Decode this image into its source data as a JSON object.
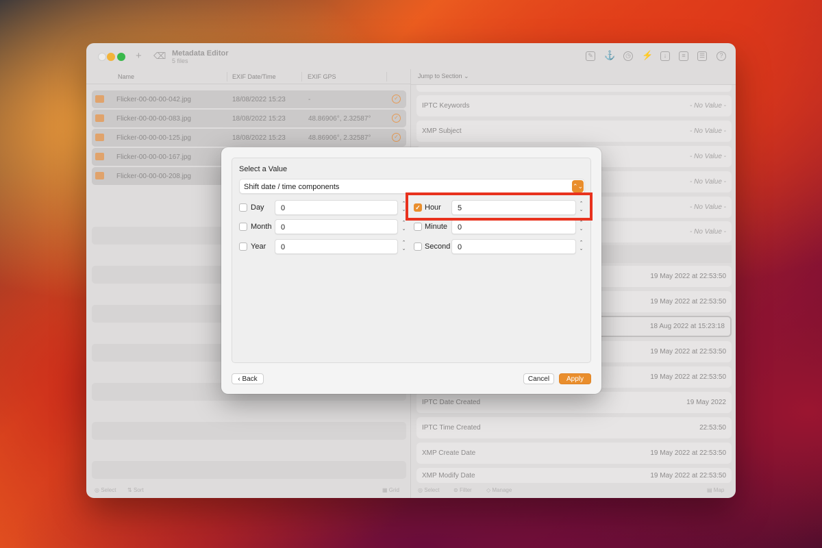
{
  "window": {
    "title": "Metadata Editor",
    "subtitle": "5 files",
    "add_icon": "plus-icon",
    "remove_icon": "delete-icon"
  },
  "toolbar_icons": [
    "edit-icon",
    "anchor-icon",
    "clock-icon",
    "lightning-icon",
    "import-icon",
    "document-icon",
    "list-icon",
    "help-icon"
  ],
  "file_list": {
    "columns": [
      "Name",
      "EXIF Date/Time",
      "EXIF GPS"
    ],
    "rows": [
      {
        "name": "Flicker-00-00-00-042.jpg",
        "date": "18/08/2022 15:23",
        "gps": "-"
      },
      {
        "name": "Flicker-00-00-00-083.jpg",
        "date": "18/08/2022 15:23",
        "gps": "48.86906°, 2.32587°"
      },
      {
        "name": "Flicker-00-00-00-125.jpg",
        "date": "18/08/2022 15:23",
        "gps": "48.86906°, 2.32587°"
      },
      {
        "name": "Flicker-00-00-00-167.jpg",
        "date": "",
        "gps": ""
      },
      {
        "name": "Flicker-00-00-00-208.jpg",
        "date": "",
        "gps": ""
      }
    ],
    "footer": {
      "select": "Select",
      "sort": "Sort",
      "grid": "Grid"
    }
  },
  "inspector": {
    "jump_label": "Jump to Section ⌄",
    "fields": [
      {
        "label": "IPTC Keywords",
        "value": "- No Value -",
        "empty": true
      },
      {
        "label": "XMP Subject",
        "value": "- No Value -",
        "empty": true
      },
      {
        "label": "",
        "value": "- No Value -",
        "empty": true
      },
      {
        "label": "",
        "value": "- No Value -",
        "empty": true
      },
      {
        "label": "",
        "value": "- No Value -",
        "empty": true
      },
      {
        "label": "",
        "value": "- No Value -",
        "empty": true
      },
      {
        "label": "",
        "value": "19 May 2022 at 22:53:50",
        "empty": false
      },
      {
        "label": "",
        "value": "19 May 2022 at 22:53:50",
        "empty": false
      },
      {
        "label": "",
        "value": "18 Aug 2022 at 15:23:18",
        "empty": false
      },
      {
        "label": "",
        "value": "19 May 2022 at 22:53:50",
        "empty": false
      },
      {
        "label": "",
        "value": "19 May 2022 at 22:53:50",
        "empty": false
      },
      {
        "label": "IPTC Date Created",
        "value": "19 May 2022",
        "empty": false
      },
      {
        "label": "IPTC Time Created",
        "value": "22:53:50",
        "empty": false
      },
      {
        "label": "XMP Create Date",
        "value": "19 May 2022 at 22:53:50",
        "empty": false
      },
      {
        "label": "XMP Modify Date",
        "value": "19 May 2022 at 22:53:50",
        "empty": false
      }
    ],
    "footer": {
      "select": "Select",
      "filter": "Filter",
      "manage": "Manage",
      "map": "Map"
    }
  },
  "dialog": {
    "title": "Select a Value",
    "mode": "Shift date / time components",
    "components": {
      "day": {
        "label": "Day",
        "value": "0",
        "checked": false
      },
      "month": {
        "label": "Month",
        "value": "0",
        "checked": false
      },
      "year": {
        "label": "Year",
        "value": "0",
        "checked": false
      },
      "hour": {
        "label": "Hour",
        "value": "5",
        "checked": true
      },
      "minute": {
        "label": "Minute",
        "value": "0",
        "checked": false
      },
      "second": {
        "label": "Second",
        "value": "0",
        "checked": false
      }
    },
    "back_label": "Back",
    "cancel_label": "Cancel",
    "apply_label": "Apply"
  },
  "colors": {
    "accent": "#e98e2d",
    "highlight": "#e8321e"
  }
}
